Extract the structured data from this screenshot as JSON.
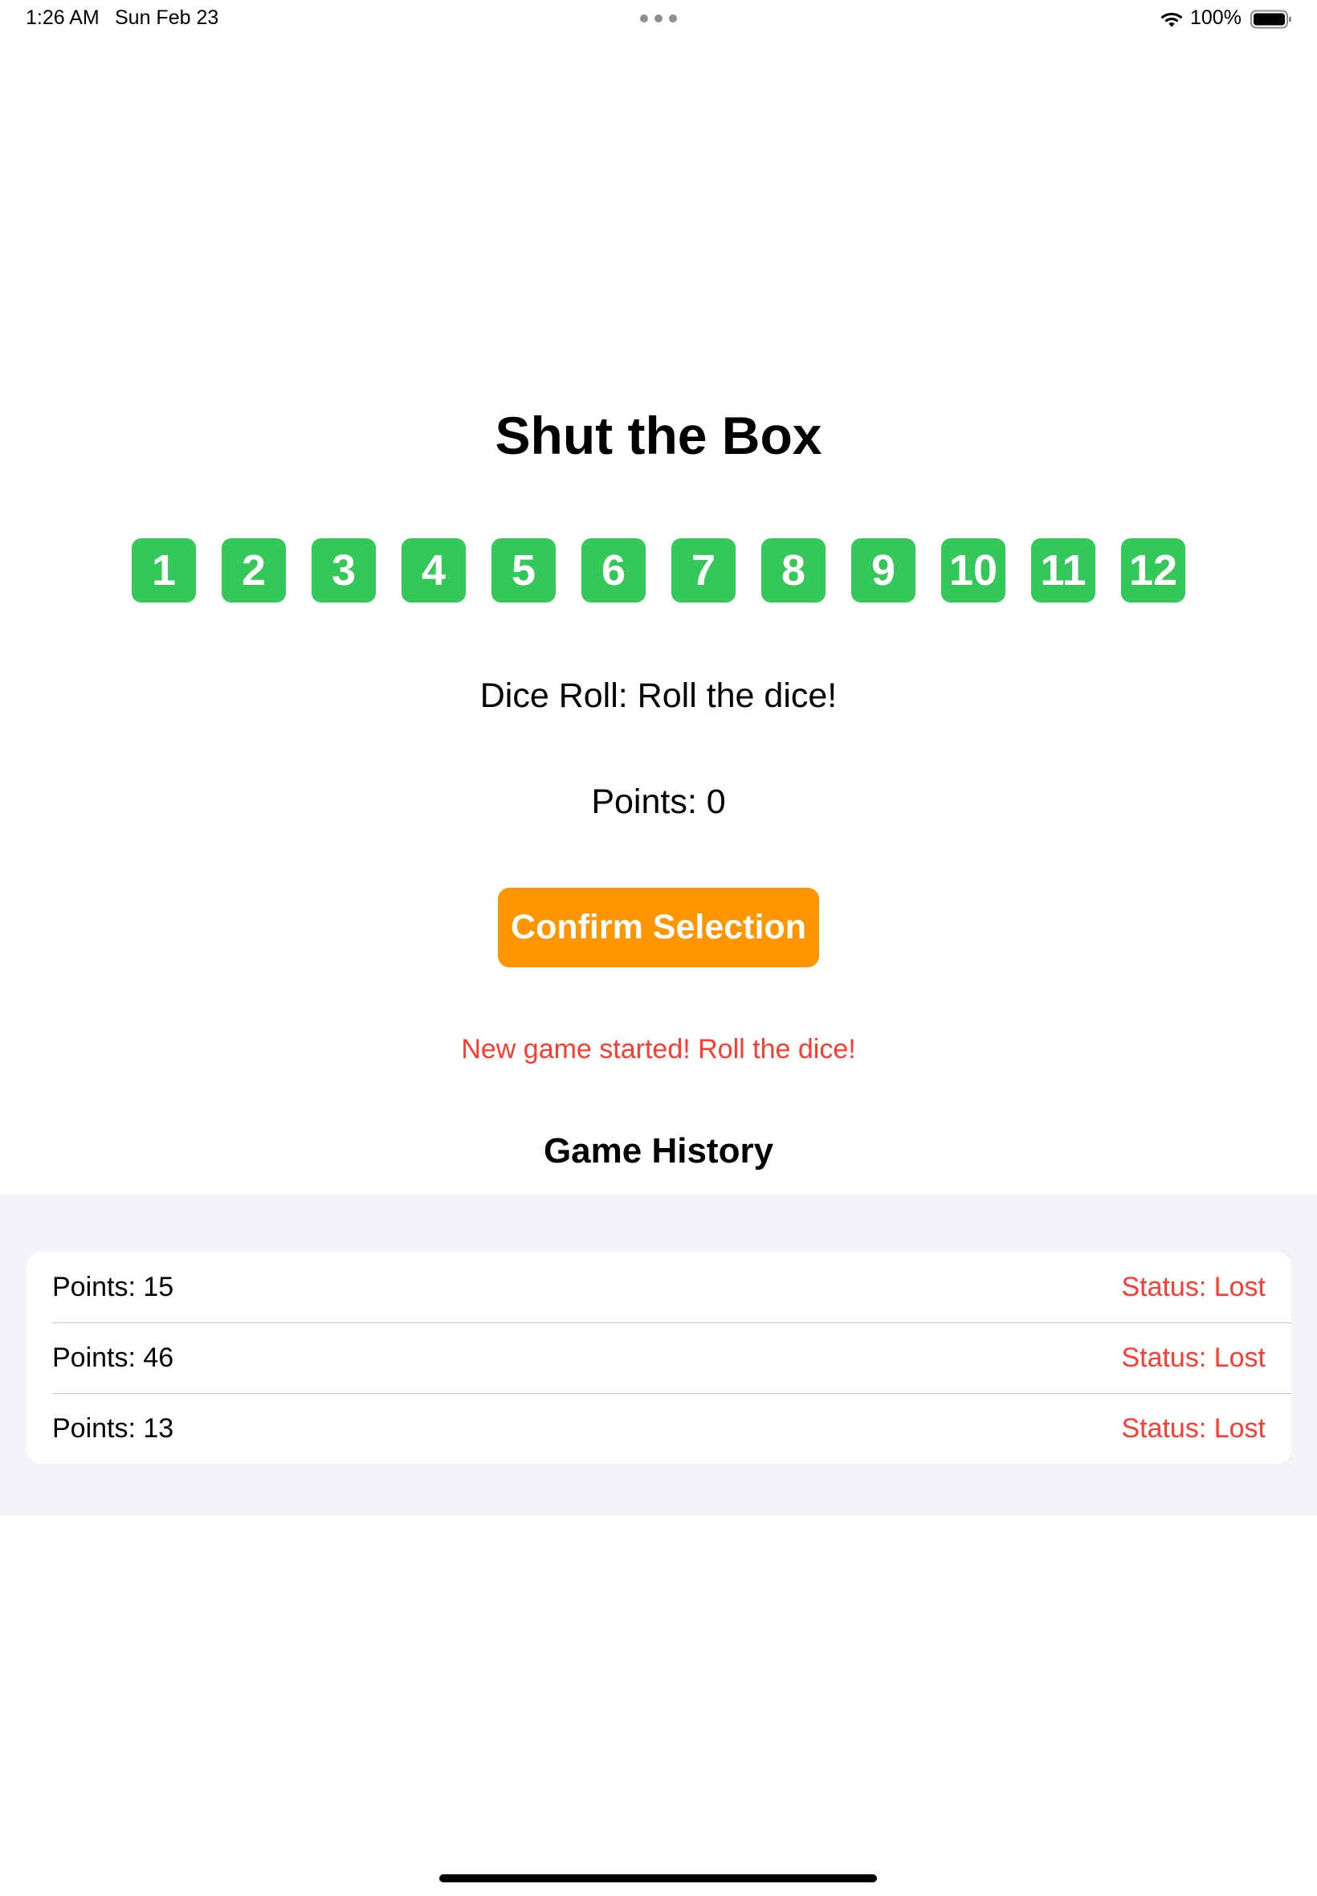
{
  "status_bar": {
    "time": "1:26 AM",
    "date": "Sun Feb 23",
    "battery": "100%",
    "icons": [
      "wifi-icon",
      "battery-icon",
      "multitask-dots-icon"
    ]
  },
  "game": {
    "title": "Shut the Box",
    "tiles": [
      "1",
      "2",
      "3",
      "4",
      "5",
      "6",
      "7",
      "8",
      "9",
      "10",
      "11",
      "12"
    ],
    "dice_roll": "Dice Roll: Roll the dice!",
    "points": "Points: 0",
    "confirm_label": "Confirm Selection",
    "message": "New game started! Roll the dice!"
  },
  "history": {
    "title": "Game History",
    "rows": [
      {
        "points": "Points: 15",
        "status": "Status: Lost"
      },
      {
        "points": "Points: 46",
        "status": "Status: Lost"
      },
      {
        "points": "Points: 13",
        "status": "Status: Lost"
      }
    ]
  },
  "colors": {
    "tile": "#34c759",
    "button": "#ff9500",
    "message": "#ff3b30",
    "status": "#ff3b30",
    "history_background": "#f2f2f7"
  }
}
